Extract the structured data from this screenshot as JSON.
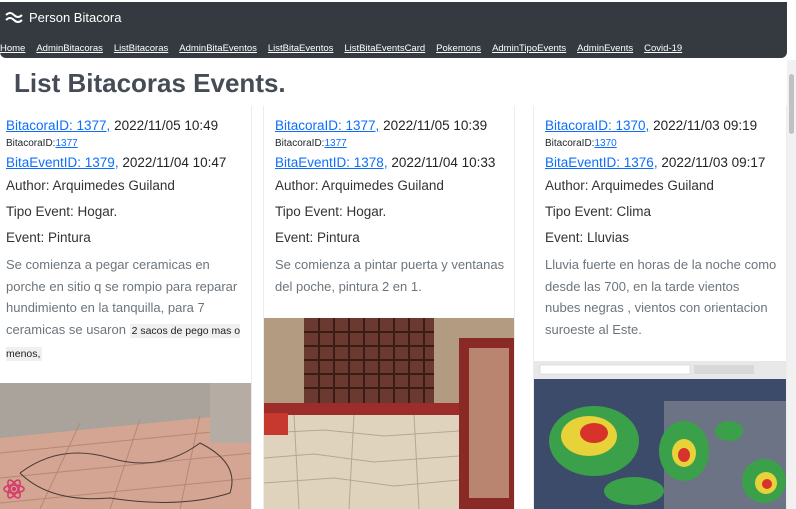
{
  "app": {
    "title": "Person Bitacora"
  },
  "nav": {
    "links": [
      "Home",
      "AdminBitacoras",
      "ListBitacoras",
      "AdminBitaEventos",
      "ListBitaEventos",
      "ListBitaEventsCard",
      "Pokemons",
      "AdminTipoEvents",
      "AdminEvents",
      "Covid-19"
    ]
  },
  "page": {
    "title": "List Bitacoras Events."
  },
  "cards": [
    {
      "bitacora_link": "BitacoraID: 1377,",
      "bitacora_date": " 2022/11/05 10:49",
      "bitacora_small_label": "BitacoraID:",
      "bitacora_small_id": "1377",
      "event_link": "BitaEventID: 1379,",
      "event_date": " 2022/11/04 10:47",
      "author": "Author: Arquimedes Guiland",
      "tipo": "Tipo Event: Hogar.",
      "event": "Event: Pintura",
      "description": "Se comienza a pegar ceramicas en porche en sitio q se rompio para reparar hundimiento en la tanquilla, para 7 ceramicas se usaron",
      "description_highlight": "2 sacos de pego mas o menos,"
    },
    {
      "bitacora_link": "BitacoraID: 1377,",
      "bitacora_date": " 2022/11/05 10:39",
      "bitacora_small_label": "BitacoraID:",
      "bitacora_small_id": "1377",
      "event_link": "BitaEventID: 1378,",
      "event_date": " 2022/11/04 10:33",
      "author": "Author: Arquimedes Guiland",
      "tipo": "Tipo Event: Hogar.",
      "event": "Event: Pintura",
      "description": "Se comienza a pintar puerta y ventanas del poche, pintura 2 en 1.",
      "description_highlight": ""
    },
    {
      "bitacora_link": "BitacoraID: 1370,",
      "bitacora_date": " 2022/11/03 09:19",
      "bitacora_small_label": "BitacoraID:",
      "bitacora_small_id": "1370",
      "event_link": "BitaEventID: 1376,",
      "event_date": " 2022/11/03 09:17",
      "author": "Author: Arquimedes Guiland",
      "tipo": "Tipo Event: Clima",
      "event": "Event: Lluvias",
      "description": "Lluvia fuerte en horas de la noche como desde las 700, en la tarde vientos nubes negras , vientos con orientacion suroeste al Este.",
      "description_highlight": ""
    }
  ],
  "colors": {
    "navbar": "#343a40",
    "link": "#0d6efd",
    "title": "#454c55",
    "muted": "#6c757d"
  }
}
